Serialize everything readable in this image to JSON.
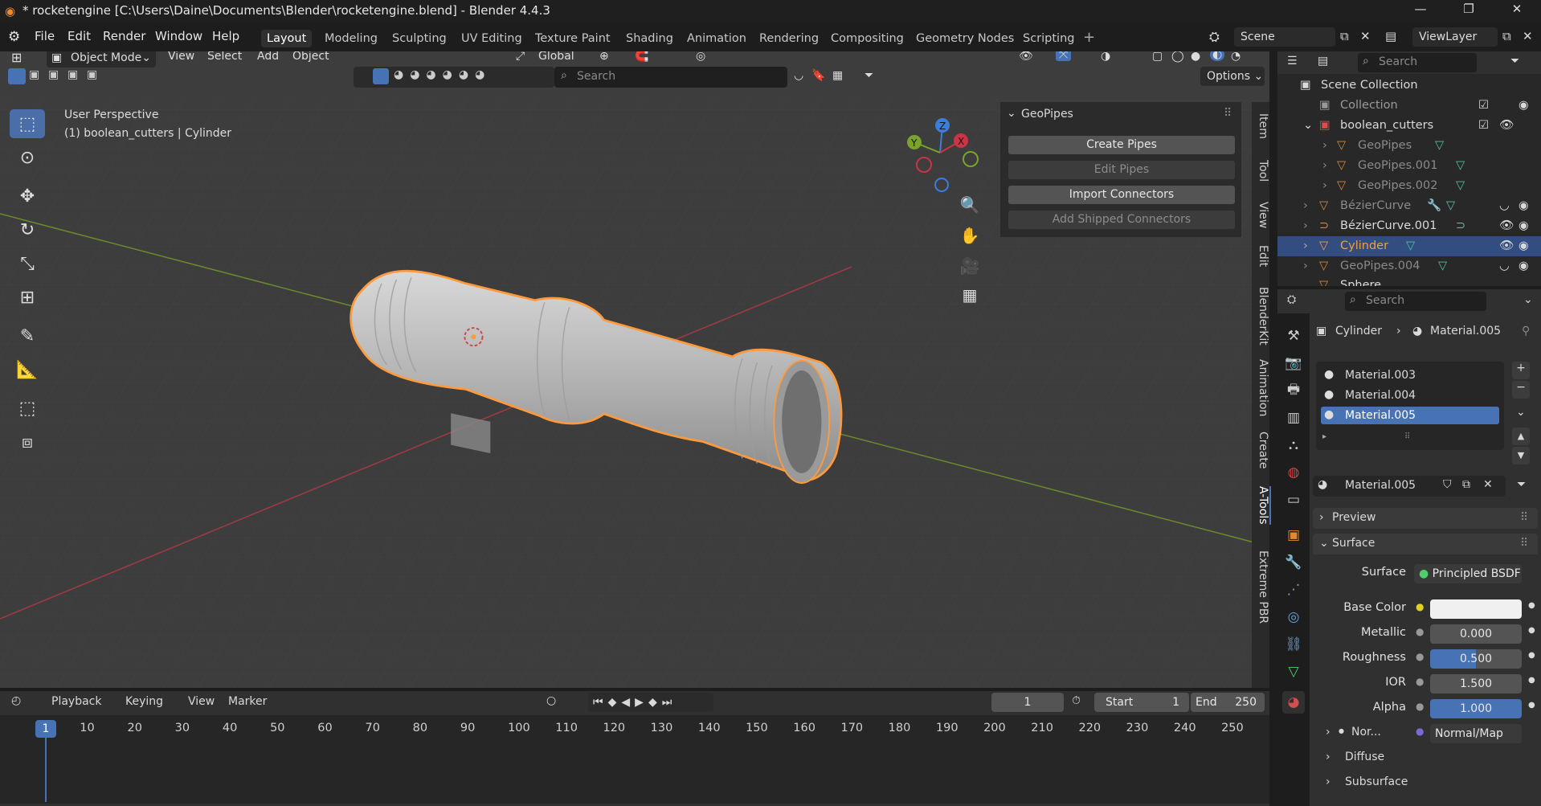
{
  "window": {
    "title": "* rocketengine [C:\\Users\\Daine\\Documents\\Blender\\rocketengine.blend] - Blender 4.4.3"
  },
  "menu": {
    "items": [
      "File",
      "Edit",
      "Render",
      "Window",
      "Help"
    ]
  },
  "workspaces": [
    "Layout",
    "Modeling",
    "Sculpting",
    "UV Editing",
    "Texture Paint",
    "Shading",
    "Animation",
    "Rendering",
    "Compositing",
    "Geometry Nodes",
    "Scripting"
  ],
  "active_workspace": "Layout",
  "scene": {
    "name": "Scene",
    "view_layer": "ViewLayer"
  },
  "viewport": {
    "mode": "Object Mode",
    "menus": [
      "View",
      "Select",
      "Add",
      "Object"
    ],
    "transform_orientation": "Global",
    "perspective_label": "User Perspective",
    "context_label": "(1) boolean_cutters | Cylinder",
    "search_placeholder": "Search",
    "options_label": "Options"
  },
  "gizmo": {
    "x": "X",
    "y": "Y",
    "z": "Z"
  },
  "npanel": {
    "header": "GeoPipes",
    "buttons": [
      {
        "label": "Create Pipes",
        "enabled": true
      },
      {
        "label": "Edit Pipes",
        "enabled": false
      },
      {
        "label": "Import Connectors",
        "enabled": true
      },
      {
        "label": "Add Shipped Connectors",
        "enabled": false
      }
    ],
    "tabs": [
      "Item",
      "Tool",
      "View",
      "Edit",
      "BlenderKit",
      "Animation",
      "Create",
      "A-Tools",
      "Extreme PBR"
    ]
  },
  "outliner": {
    "search_placeholder": "Search",
    "rows": [
      {
        "label": "Scene Collection",
        "indent": 0
      },
      {
        "label": "Collection",
        "indent": 1
      },
      {
        "label": "boolean_cutters",
        "indent": 1
      },
      {
        "label": "GeoPipes",
        "indent": 2
      },
      {
        "label": "GeoPipes.001",
        "indent": 2
      },
      {
        "label": "GeoPipes.002",
        "indent": 2
      },
      {
        "label": "BézierCurve",
        "indent": 1
      },
      {
        "label": "BézierCurve.001",
        "indent": 1
      },
      {
        "label": "Cylinder",
        "indent": 1
      },
      {
        "label": "GeoPipes.004",
        "indent": 1
      },
      {
        "label": "Sphere",
        "indent": 1
      }
    ],
    "selected": "Cylinder"
  },
  "properties": {
    "search_placeholder": "Search",
    "breadcrumb": {
      "object": "Cylinder",
      "material": "Material.005"
    },
    "material_slots": [
      "Material.003",
      "Material.004",
      "Material.005"
    ],
    "active_slot": "Material.005",
    "material_name": "Material.005",
    "sections": {
      "preview": "Preview",
      "surface": "Surface",
      "diffuse": "Diffuse",
      "subsurface": "Subsurface"
    },
    "surface": {
      "surface_label": "Surface",
      "surface_value": "Principled BSDF",
      "base_color_label": "Base Color",
      "base_color": "#f0f0f0",
      "metallic_label": "Metallic",
      "metallic": "0.000",
      "roughness_label": "Roughness",
      "roughness": "0.500",
      "ior_label": "IOR",
      "ior": "1.500",
      "alpha_label": "Alpha",
      "alpha": "1.000",
      "normal_label": "Nor...",
      "normal_value": "Normal/Map"
    }
  },
  "timeline": {
    "menus": [
      "Playback",
      "Keying",
      "View",
      "Marker"
    ],
    "current_frame": "1",
    "start_label": "Start",
    "start": "1",
    "end_label": "End",
    "end": "250",
    "ticks": [
      "1",
      "10",
      "20",
      "30",
      "40",
      "50",
      "60",
      "70",
      "80",
      "90",
      "100",
      "110",
      "120",
      "130",
      "140",
      "150",
      "160",
      "170",
      "180",
      "190",
      "200",
      "210",
      "220",
      "230",
      "240",
      "250"
    ]
  },
  "colors": {
    "accent": "#4772b3",
    "selection_outline": "#ff9a3c",
    "axis_x": "#cc3344",
    "axis_y": "#7aa32c",
    "axis_z": "#3b7dd8"
  }
}
